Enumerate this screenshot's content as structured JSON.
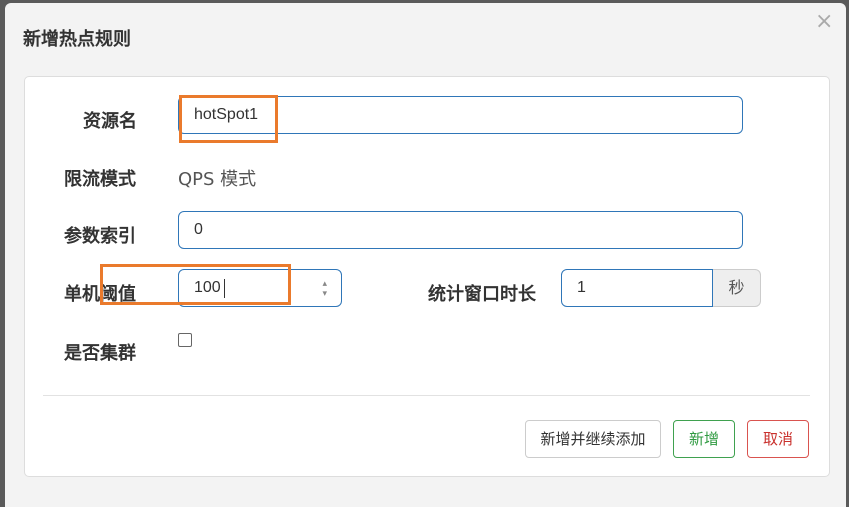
{
  "dialog": {
    "title": "新增热点规则",
    "close_glyph": "×"
  },
  "form": {
    "resource_name": {
      "label": "资源名",
      "value": "hotSpot1"
    },
    "flow_mode": {
      "label": "限流模式",
      "value": "QPS 模式"
    },
    "param_index": {
      "label": "参数索引",
      "value": "0"
    },
    "threshold": {
      "label": "单机阈值",
      "value": "100"
    },
    "window": {
      "label": "统计窗口时长",
      "value": "1",
      "unit": "秒"
    },
    "cluster": {
      "label": "是否集群",
      "checked": false
    }
  },
  "buttons": {
    "add_continue": "新增并继续添加",
    "add": "新增",
    "cancel": "取消"
  },
  "colors": {
    "highlight": "#ea7a2c",
    "input_border": "#2f76b8",
    "success": "#3fa14f",
    "danger": "#d9534f"
  }
}
